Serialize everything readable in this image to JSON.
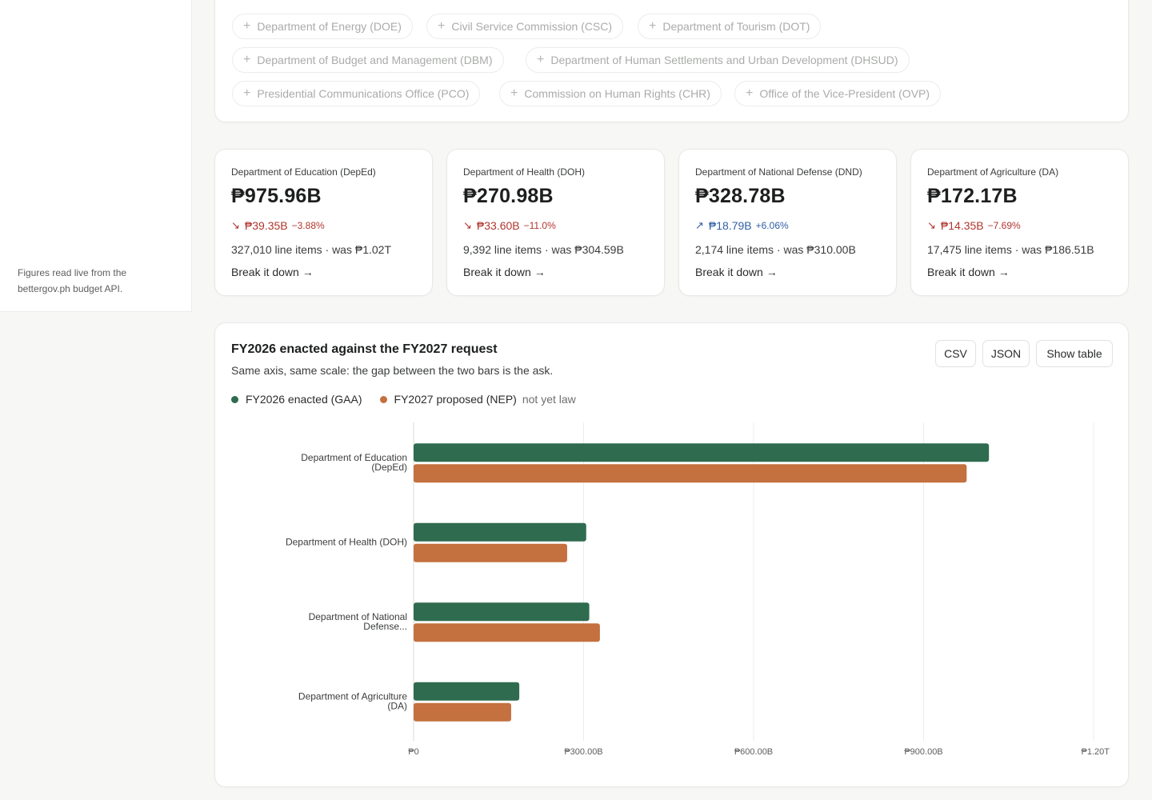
{
  "sidebar": {
    "note": "Figures read live from the bettergov.ph budget API."
  },
  "chips": [
    {
      "label": "Department of Energy (DOE)"
    },
    {
      "label": "Civil Service Commission (CSC)"
    },
    {
      "label": "Department of Tourism (DOT)"
    },
    {
      "label": "Department of Budget and Management (DBM)"
    },
    {
      "label": "Department of Human Settlements and Urban Development (DHSUD)"
    },
    {
      "label": "Presidential Communications Office (PCO)"
    },
    {
      "label": "Commission on Human Rights (CHR)"
    },
    {
      "label": "Office of the Vice-President (OVP)"
    }
  ],
  "stats": [
    {
      "dept": "Department of Education (DepEd)",
      "amount": "₱975.96B",
      "direction": "down",
      "arrow": "↘",
      "delta": "₱39.35B",
      "pct": "−3.88%",
      "meta": "327,010 line items · was ₱1.02T",
      "link": "Break it down →"
    },
    {
      "dept": "Department of Health (DOH)",
      "amount": "₱270.98B",
      "direction": "down",
      "arrow": "↘",
      "delta": "₱33.60B",
      "pct": "−11.0%",
      "meta": "9,392 line items · was ₱304.59B",
      "link": "Break it down →"
    },
    {
      "dept": "Department of National Defense (DND)",
      "amount": "₱328.78B",
      "direction": "up",
      "arrow": "↗",
      "delta": "₱18.79B",
      "pct": "+6.06%",
      "meta": "2,174 line items · was ₱310.00B",
      "link": "Break it down →"
    },
    {
      "dept": "Department of Agriculture (DA)",
      "amount": "₱172.17B",
      "direction": "down",
      "arrow": "↘",
      "delta": "₱14.35B",
      "pct": "−7.69%",
      "meta": "17,475 line items · was ₱186.51B",
      "link": "Break it down →"
    }
  ],
  "chart": {
    "title": "FY2026 enacted against the FY2027 request",
    "subtitle": "Same axis, same scale: the gap between the two bars is the ask.",
    "buttons": {
      "csv": "CSV",
      "json": "JSON",
      "table": "Show table"
    },
    "legend_note": "not yet law"
  },
  "colors": {
    "enacted": "#2f6b4f",
    "proposed": "#c4703f",
    "grid": "#ececea"
  },
  "chart_data": {
    "type": "bar",
    "orientation": "horizontal",
    "categories": [
      [
        "Department of Education",
        "(DepEd)"
      ],
      [
        "Department of Health (DOH)"
      ],
      [
        "Department of National",
        "Defense..."
      ],
      [
        "Department of Agriculture",
        "(DA)"
      ]
    ],
    "series": [
      {
        "name": "FY2026 enacted (GAA)",
        "values": [
          1015.31,
          304.59,
          310.0,
          186.51
        ]
      },
      {
        "name": "FY2027 proposed (NEP)",
        "values": [
          975.96,
          270.98,
          328.78,
          172.17
        ]
      }
    ],
    "xlim": [
      0,
      1200
    ],
    "x_ticks": [
      {
        "value": 0,
        "label": "₱0"
      },
      {
        "value": 300,
        "label": "₱300.00B"
      },
      {
        "value": 600,
        "label": "₱600.00B"
      },
      {
        "value": 900,
        "label": "₱900.00B"
      },
      {
        "value": 1200,
        "label": "₱1.20T"
      }
    ],
    "grid": true,
    "legend_position": "top-left"
  }
}
